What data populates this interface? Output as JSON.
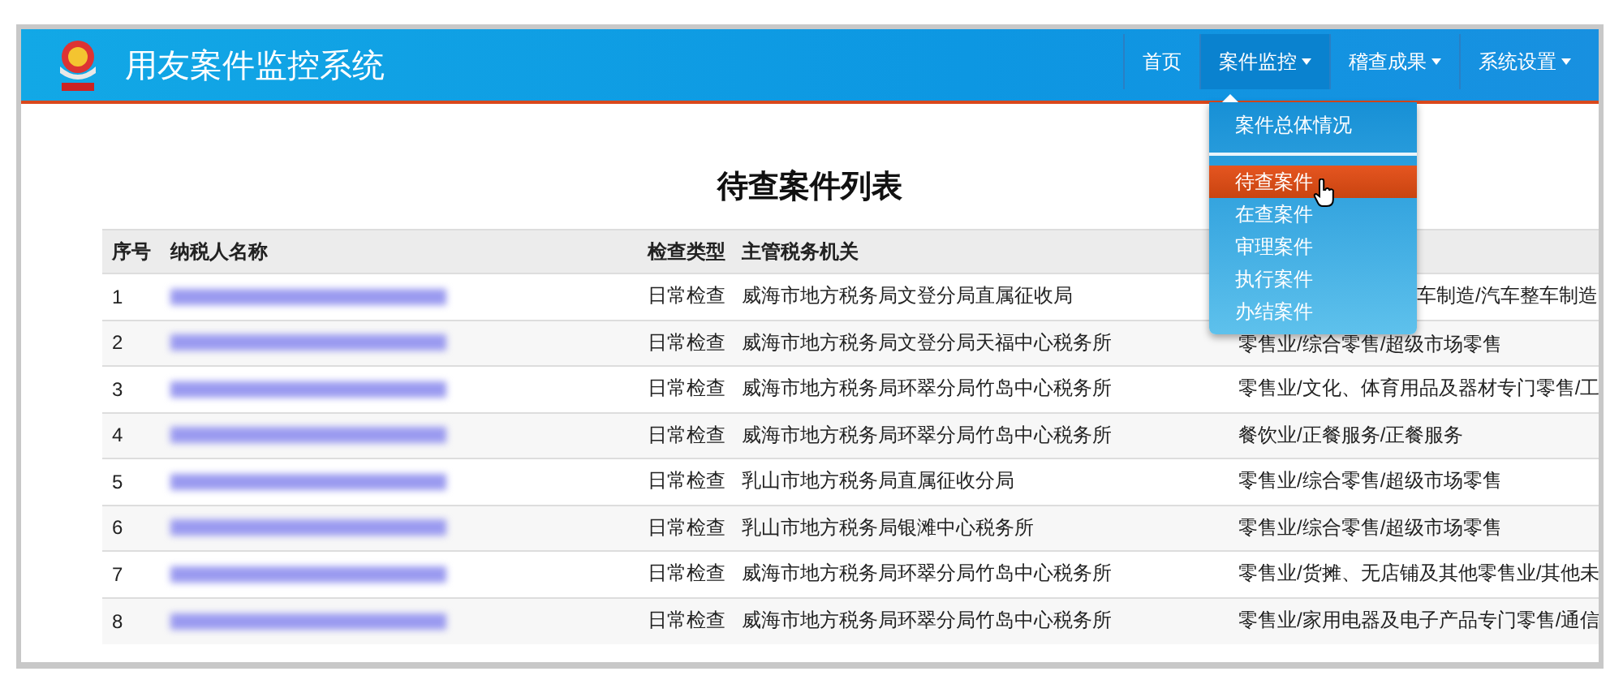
{
  "header": {
    "title": "用友案件监控系统"
  },
  "nav": [
    {
      "label": "首页",
      "has_menu": false,
      "selected": false
    },
    {
      "label": "案件监控",
      "has_menu": true,
      "selected": true
    },
    {
      "label": "稽查成果",
      "has_menu": true,
      "selected": false
    },
    {
      "label": "系统设置",
      "has_menu": true,
      "selected": false
    }
  ],
  "dropdown": {
    "items": [
      {
        "label": "案件总体情况",
        "selected": false,
        "divider_after": true
      },
      {
        "label": "待查案件",
        "selected": true,
        "divider_after": false
      },
      {
        "label": "在查案件",
        "selected": false,
        "divider_after": false
      },
      {
        "label": "审理案件",
        "selected": false,
        "divider_after": false
      },
      {
        "label": "执行案件",
        "selected": false,
        "divider_after": false
      },
      {
        "label": "办结案件",
        "selected": false,
        "divider_after": false
      }
    ]
  },
  "page_title": "待查案件列表",
  "table": {
    "columns": [
      "序号",
      "纳税人名称",
      "检查类型",
      "主管税务机关"
    ],
    "rows": [
      {
        "no": "1",
        "check_type": "日常检查",
        "office": "威海市地方税务局文登分局直属征收局",
        "industry": "车制造/汽车整车制造"
      },
      {
        "no": "2",
        "check_type": "日常检查",
        "office": "威海市地方税务局文登分局天福中心税务所",
        "industry": "零售业/综合零售/超级市场零售"
      },
      {
        "no": "3",
        "check_type": "日常检查",
        "office": "威海市地方税务局环翠分局竹岛中心税务所",
        "industry": "零售业/文化、体育用品及器材专门零售/工"
      },
      {
        "no": "4",
        "check_type": "日常检查",
        "office": "威海市地方税务局环翠分局竹岛中心税务所",
        "industry": "餐饮业/正餐服务/正餐服务"
      },
      {
        "no": "5",
        "check_type": "日常检查",
        "office": "乳山市地方税务局直属征收分局",
        "industry": "零售业/综合零售/超级市场零售"
      },
      {
        "no": "6",
        "check_type": "日常检查",
        "office": "乳山市地方税务局银滩中心税务所",
        "industry": "零售业/综合零售/超级市场零售"
      },
      {
        "no": "7",
        "check_type": "日常检查",
        "office": "威海市地方税务局环翠分局竹岛中心税务所",
        "industry": "零售业/货摊、无店铺及其他零售业/其他未"
      },
      {
        "no": "8",
        "check_type": "日常检查",
        "office": "威海市地方税务局环翠分局竹岛中心税务所",
        "industry": "零售业/家用电器及电子产品专门零售/通信"
      }
    ]
  }
}
